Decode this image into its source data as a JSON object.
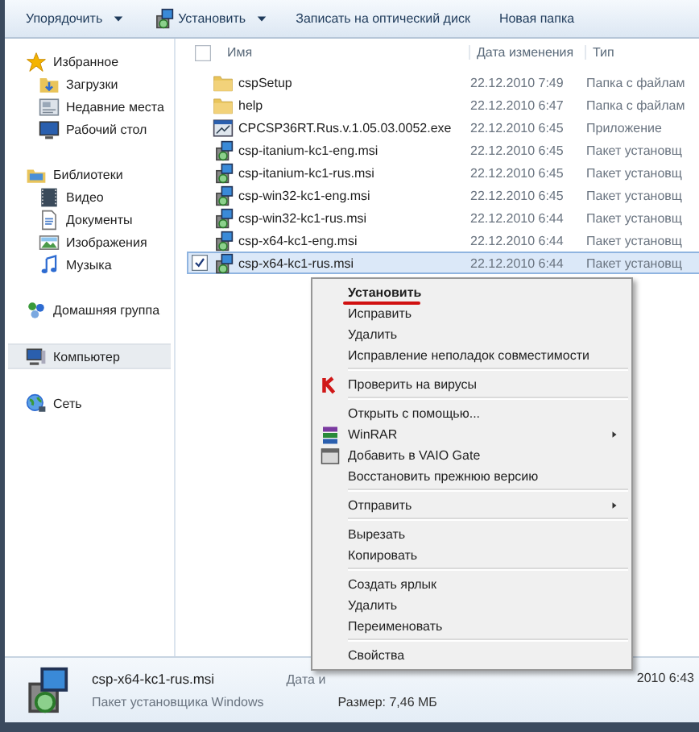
{
  "toolbar": {
    "buttons": [
      {
        "label": "Упорядочить",
        "kind": "menu"
      },
      {
        "label": "Установить",
        "kind": "install"
      },
      {
        "label": "Записать на оптический диск",
        "kind": "plain"
      },
      {
        "label": "Новая папка",
        "kind": "plain"
      }
    ]
  },
  "sidebar": {
    "items": [
      {
        "label": "Избранное",
        "selected": false,
        "children": [
          {
            "label": "Загрузки",
            "selected": false
          },
          {
            "label": "Недавние места",
            "selected": false
          },
          {
            "label": "Рабочий стол",
            "selected": false
          }
        ]
      },
      {
        "label": "Библиотеки",
        "selected": false,
        "children": [
          {
            "label": "Видео",
            "selected": false
          },
          {
            "label": "Документы",
            "selected": false
          },
          {
            "label": "Изображения",
            "selected": false
          },
          {
            "label": "Музыка",
            "selected": false
          }
        ]
      },
      {
        "label": "Домашняя группа",
        "selected": false
      },
      {
        "label": "Компьютер",
        "selected": true
      },
      {
        "label": "Сеть",
        "selected": false
      }
    ]
  },
  "table": {
    "select_all": {
      "checked": false
    },
    "columns": [
      "Имя",
      "Дата изменения",
      "Тип"
    ],
    "rows": [
      {
        "name": "cspSetup",
        "date": "22.12.2010 7:49",
        "type": "Папка с файлам",
        "kind": "folder",
        "checked": false,
        "selected": false
      },
      {
        "name": "help",
        "date": "22.12.2010 6:47",
        "type": "Папка с файлам",
        "kind": "folder",
        "checked": false,
        "selected": false
      },
      {
        "name": "CPCSP36RT.Rus.v.1.05.03.0052.exe",
        "date": "22.12.2010 6:45",
        "type": "Приложение",
        "kind": "exe",
        "checked": false,
        "selected": false
      },
      {
        "name": "csp-itanium-kc1-eng.msi",
        "date": "22.12.2010 6:45",
        "type": "Пакет установщ",
        "kind": "msi",
        "checked": false,
        "selected": false
      },
      {
        "name": "csp-itanium-kc1-rus.msi",
        "date": "22.12.2010 6:45",
        "type": "Пакет установщ",
        "kind": "msi",
        "checked": false,
        "selected": false
      },
      {
        "name": "csp-win32-kc1-eng.msi",
        "date": "22.12.2010 6:45",
        "type": "Пакет установщ",
        "kind": "msi",
        "checked": false,
        "selected": false
      },
      {
        "name": "csp-win32-kc1-rus.msi",
        "date": "22.12.2010 6:44",
        "type": "Пакет установщ",
        "kind": "msi",
        "checked": false,
        "selected": false
      },
      {
        "name": "csp-x64-kc1-eng.msi",
        "date": "22.12.2010 6:44",
        "type": "Пакет установщ",
        "kind": "msi",
        "checked": false,
        "selected": false
      },
      {
        "name": "csp-x64-kc1-rus.msi",
        "date": "22.12.2010 6:44",
        "type": "Пакет установщ",
        "kind": "msi",
        "checked": true,
        "selected": true
      }
    ]
  },
  "context_menu": {
    "groups": [
      [
        {
          "label": "Установить",
          "default": true,
          "submenu": false
        },
        {
          "label": "Исправить",
          "default": false,
          "submenu": false
        },
        {
          "label": "Удалить",
          "default": false,
          "submenu": false
        },
        {
          "label": "Исправление неполадок совместимости",
          "default": false,
          "submenu": false
        }
      ],
      [
        {
          "label": "Проверить на вирусы",
          "default": false,
          "submenu": false
        }
      ],
      [
        {
          "label": "Открыть с помощью...",
          "default": false,
          "submenu": false
        },
        {
          "label": "WinRAR",
          "default": false,
          "submenu": true
        },
        {
          "label": "Добавить в VAIO Gate",
          "default": false,
          "submenu": false
        },
        {
          "label": "Восстановить прежнюю версию",
          "default": false,
          "submenu": false
        }
      ],
      [
        {
          "label": "Отправить",
          "default": false,
          "submenu": true
        }
      ],
      [
        {
          "label": "Вырезать",
          "default": false,
          "submenu": false
        },
        {
          "label": "Копировать",
          "default": false,
          "submenu": false
        }
      ],
      [
        {
          "label": "Создать ярлык",
          "default": false,
          "submenu": false
        },
        {
          "label": "Удалить",
          "default": false,
          "submenu": false
        },
        {
          "label": "Переименовать",
          "default": false,
          "submenu": false
        }
      ],
      [
        {
          "label": "Свойства",
          "default": false,
          "submenu": false
        }
      ]
    ]
  },
  "details": {
    "name": "csp-x64-kc1-rus.msi",
    "type": "Пакет установщика Windows",
    "date_label": "Дата и",
    "date_value": "2010 6:43",
    "size": "Размер: 7,46 МБ"
  }
}
